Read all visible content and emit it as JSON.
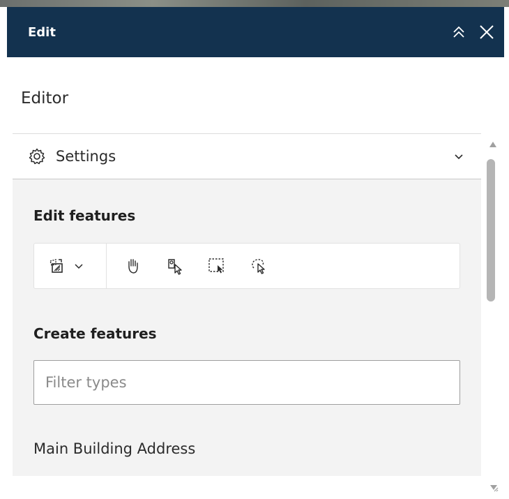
{
  "header": {
    "title": "Edit",
    "icons": {
      "collapse": "double-chevron-up-icon",
      "close": "close-icon"
    },
    "color": "#13324f"
  },
  "editor": {
    "title": "Editor",
    "settings": {
      "label": "Settings",
      "icon": "gear-icon"
    },
    "edit_features": {
      "title": "Edit features",
      "tools": [
        {
          "name": "select-by-polygon-icon"
        },
        {
          "name": "pan-hand-icon"
        },
        {
          "name": "select-feature-icon"
        },
        {
          "name": "rectangle-select-icon"
        },
        {
          "name": "lasso-select-icon"
        }
      ]
    },
    "create_features": {
      "title": "Create features",
      "filter_placeholder": "Filter types",
      "filter_value": ""
    },
    "feature_types": [
      "Main Building Address"
    ]
  }
}
